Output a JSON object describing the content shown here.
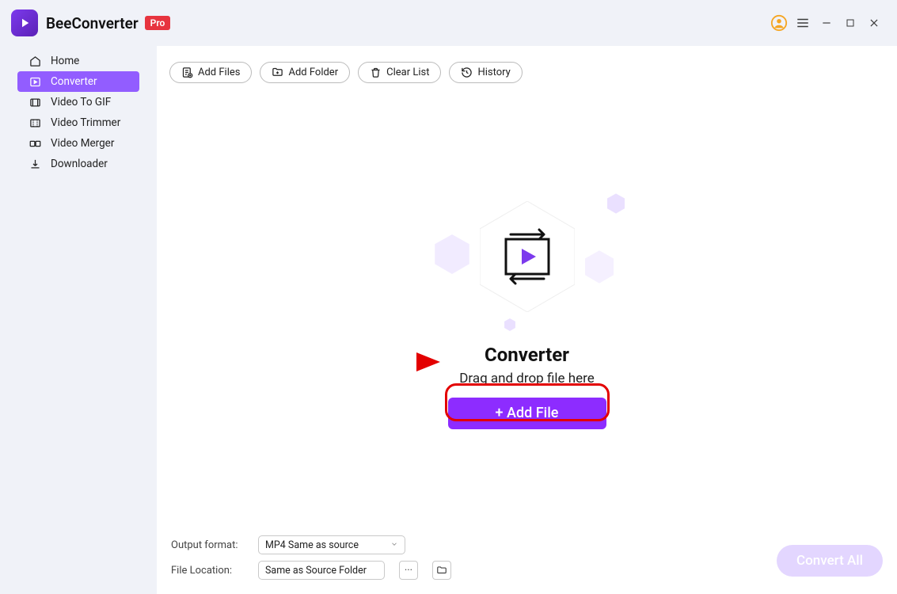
{
  "app": {
    "name": "BeeConverter",
    "badge": "Pro"
  },
  "sidebar": {
    "items": [
      {
        "label": "Home"
      },
      {
        "label": "Converter"
      },
      {
        "label": "Video To GIF"
      },
      {
        "label": "Video Trimmer"
      },
      {
        "label": "Video Merger"
      },
      {
        "label": "Downloader"
      }
    ]
  },
  "toolbar": {
    "add_files": "Add Files",
    "add_folder": "Add Folder",
    "clear_list": "Clear List",
    "history": "History"
  },
  "dropzone": {
    "title": "Converter",
    "subtitle": "Drag and drop file here",
    "button": "+ Add File"
  },
  "footer": {
    "output_label": "Output format:",
    "output_value": "MP4 Same as source",
    "location_label": "File Location:",
    "location_value": "Same as Source Folder",
    "dots": "···",
    "convert_all": "Convert All"
  }
}
